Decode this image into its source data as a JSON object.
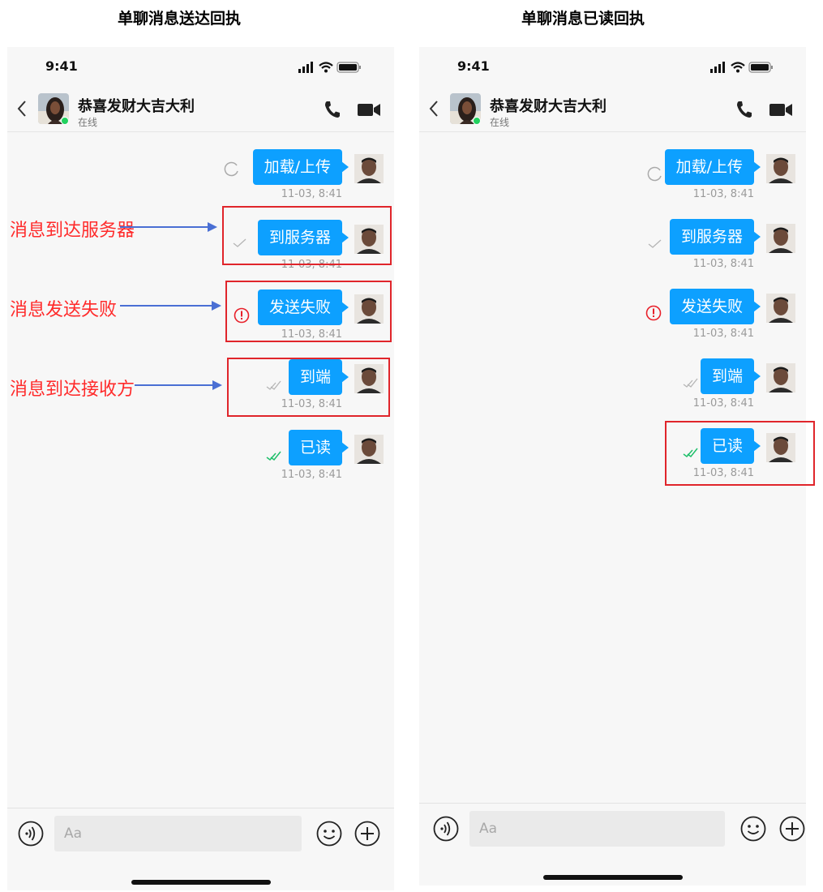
{
  "titles": {
    "left": "单聊消息送达回执",
    "right": "单聊消息已读回执"
  },
  "status_bar": {
    "time": "9:41"
  },
  "contact": {
    "name": "恭喜发财大吉大利",
    "status": "在线"
  },
  "messages": [
    {
      "text": "加载/上传",
      "time": "11-03, 8:41",
      "state": "loading"
    },
    {
      "text": "到服务器",
      "time": "11-03, 8:41",
      "state": "server"
    },
    {
      "text": "发送失败",
      "time": "11-03, 8:41",
      "state": "failed"
    },
    {
      "text": "到端",
      "time": "11-03, 8:41",
      "state": "delivered"
    },
    {
      "text": "已读",
      "time": "11-03, 8:41",
      "state": "read"
    }
  ],
  "annotations": {
    "server": "消息到达服务器",
    "failed": "消息发送失败",
    "delivered": "消息到达接收方"
  },
  "input": {
    "placeholder": "Aa"
  },
  "colors": {
    "bubble": "#0da0ff",
    "annotation": "#e0252b",
    "arrow": "#4a6fd4",
    "read_check": "#1fbf6a",
    "error": "#e8202a",
    "online": "#22d15f"
  }
}
